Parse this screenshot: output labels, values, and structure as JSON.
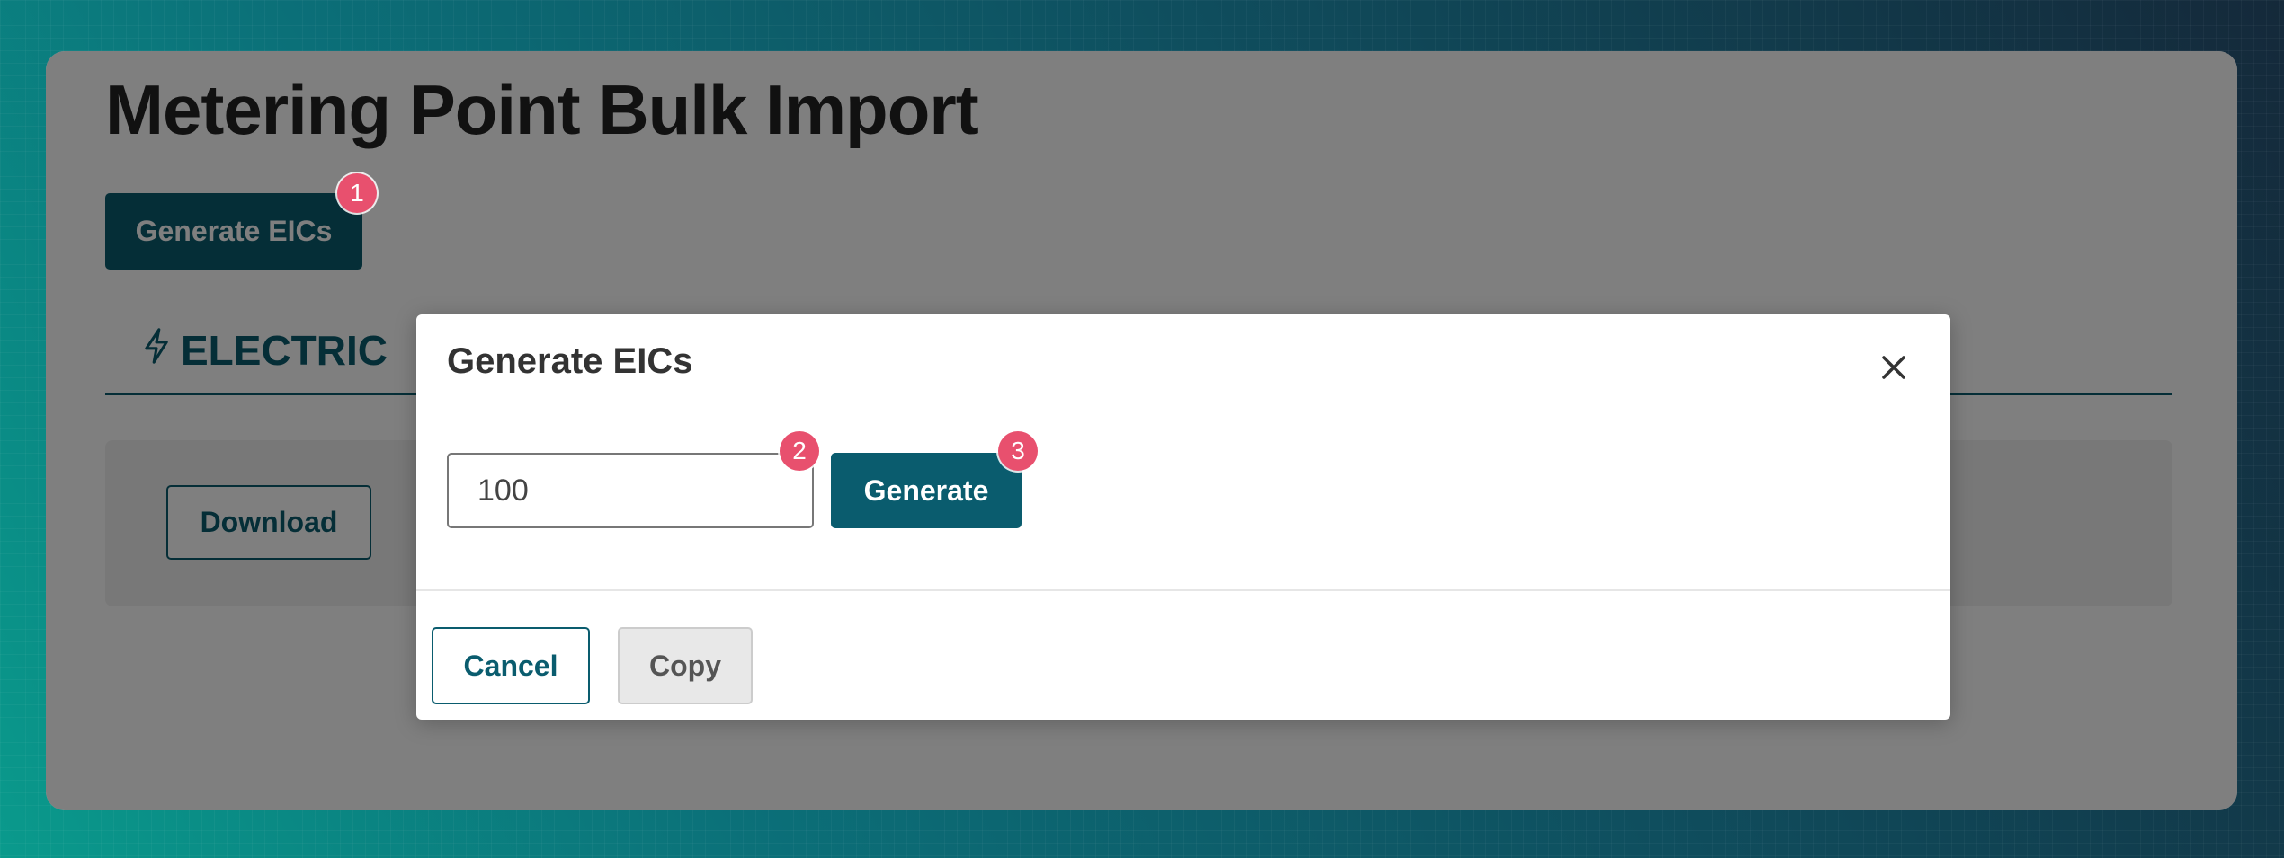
{
  "page": {
    "title": "Metering Point Bulk Import",
    "generate_eics_label": "Generate EICs",
    "tab_electricity_label": "ELECTRIC",
    "download_label": "Download"
  },
  "modal": {
    "title": "Generate EICs",
    "quantity_value": "100",
    "generate_label": "Generate",
    "cancel_label": "Cancel",
    "copy_label": "Copy"
  },
  "badges": [
    "1",
    "2",
    "3"
  ],
  "icons": {
    "tab": "lightning-bolt-icon",
    "close": "close-icon"
  },
  "colors": {
    "primary": "#0a5c6e",
    "badge": "#e8506e",
    "overlay": "rgba(0,0,0,0.5)"
  }
}
